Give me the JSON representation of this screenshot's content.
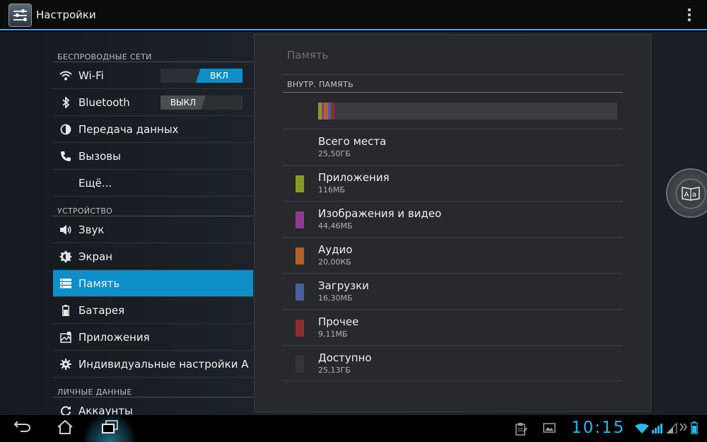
{
  "app": {
    "title": "Настройки"
  },
  "sidebar": {
    "categories": [
      "БЕСПРОВОДНЫЕ СЕТИ",
      "УСТРОЙСТВО",
      "ЛИЧНЫЕ ДАННЫЕ"
    ],
    "items": [
      {
        "label": "Wi-Fi",
        "icon": "wifi-icon",
        "toggle": "ВКЛ"
      },
      {
        "label": "Bluetooth",
        "icon": "bluetooth-icon",
        "toggle": "ВЫКЛ"
      },
      {
        "label": "Передача данных",
        "icon": "data-usage-icon"
      },
      {
        "label": "Вызовы",
        "icon": "phone-icon"
      },
      {
        "label": "Ещё..."
      },
      {
        "label": "Звук",
        "icon": "speaker-icon"
      },
      {
        "label": "Экран",
        "icon": "brightness-icon"
      },
      {
        "label": "Память",
        "icon": "storage-icon"
      },
      {
        "label": "Батарея",
        "icon": "battery-icon"
      },
      {
        "label": "Приложения",
        "icon": "apps-icon"
      },
      {
        "label": "Индивидуальные настройки A",
        "icon": "gear-icon"
      },
      {
        "label": "Аккаунты",
        "icon": "sync-icon"
      }
    ],
    "selected": "Память"
  },
  "storage": {
    "title": "Память",
    "section": "ВНУТР. ПАМЯТЬ",
    "total": {
      "label": "Всего места",
      "value": "25,50ГБ"
    },
    "entries": [
      {
        "label": "Приложения",
        "value": "116МБ",
        "color": "#8a9a2a"
      },
      {
        "label": "Изображения и видео",
        "value": "44,46МБ",
        "color": "#8f3a8f"
      },
      {
        "label": "Аудио",
        "value": "20,00КБ",
        "color": "#b4602a"
      },
      {
        "label": "Загрузки",
        "value": "16,30МБ",
        "color": "#4a5f9e"
      },
      {
        "label": "Прочее",
        "value": "9,11МБ",
        "color": "#8e2e33"
      },
      {
        "label": "Доступно",
        "value": "25,13ГБ",
        "color": "#333539"
      }
    ]
  },
  "dial": {
    "label": "A|a"
  },
  "status": {
    "clock": "10:15"
  },
  "colors": {
    "accent": "#33b5e5",
    "selection": "#0e8fc8"
  }
}
